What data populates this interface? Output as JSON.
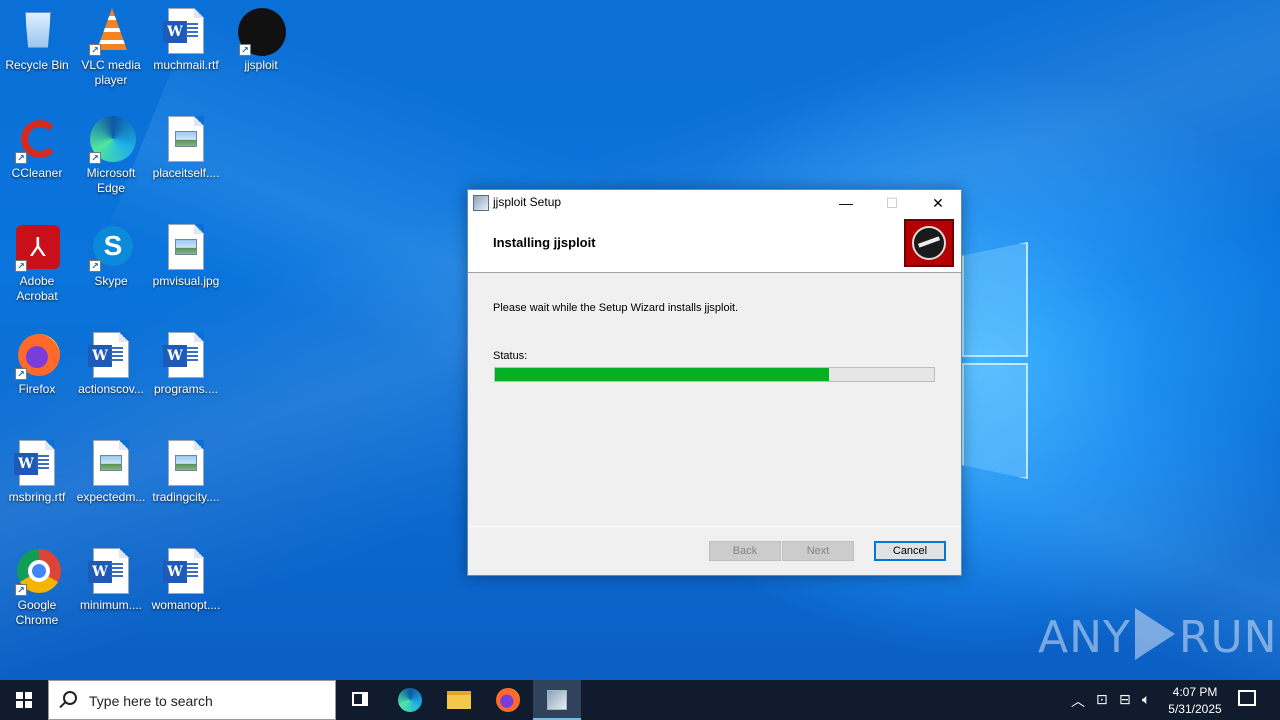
{
  "desktop": {
    "icons": [
      {
        "label": "Recycle Bin"
      },
      {
        "label": "VLC media player"
      },
      {
        "label": "muchmail.rtf"
      },
      {
        "label": "jjsploit"
      },
      {
        "label": "CCleaner"
      },
      {
        "label": "Microsoft Edge"
      },
      {
        "label": "placeitself...."
      },
      {
        "label": "Adobe Acrobat"
      },
      {
        "label": "Skype"
      },
      {
        "label": "pmvisual.jpg"
      },
      {
        "label": "Firefox"
      },
      {
        "label": "actionscov..."
      },
      {
        "label": "programs...."
      },
      {
        "label": "msbring.rtf"
      },
      {
        "label": "expectedm..."
      },
      {
        "label": "tradingcity...."
      },
      {
        "label": "Google Chrome"
      },
      {
        "label": "minimum...."
      },
      {
        "label": "womanopt...."
      }
    ]
  },
  "dialog": {
    "title": "jjsploit Setup",
    "header_title": "Installing jjsploit",
    "info_text": "Please wait while the Setup Wizard installs jjsploit.",
    "status_label": "Status:",
    "progress": 0.76,
    "progress_color": "#06b025",
    "buttons": {
      "back": "Back",
      "next": "Next",
      "cancel": "Cancel"
    }
  },
  "watermark": {
    "left": "ANY",
    "right": "RUN"
  },
  "taskbar": {
    "search_placeholder": "Type here to search",
    "clock_time": "4:07 PM",
    "clock_date": "5/31/2025"
  }
}
